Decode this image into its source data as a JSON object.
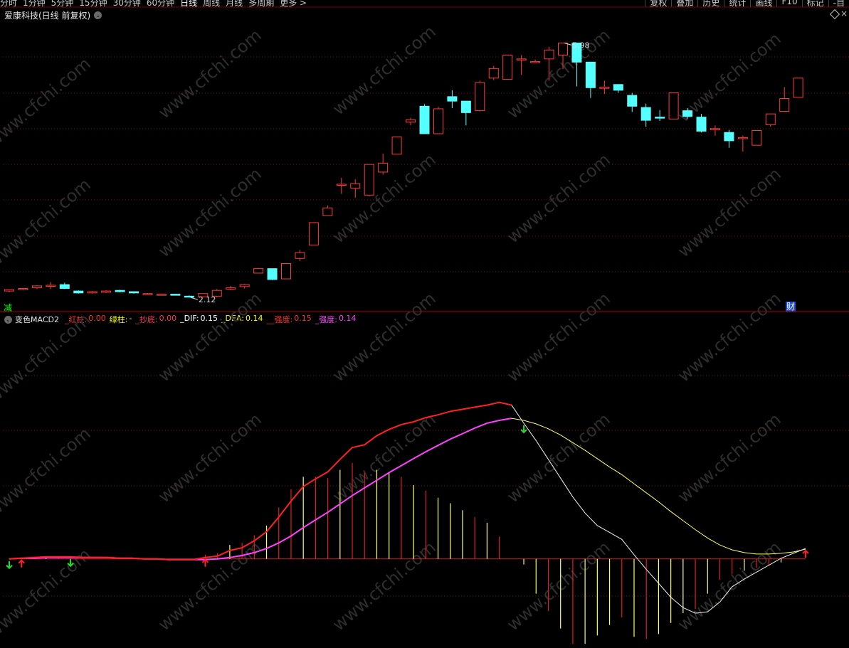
{
  "toolbar": {
    "periods": [
      "分时",
      "1分钟",
      "5分钟",
      "15分钟",
      "30分钟",
      "60分钟",
      "日线",
      "周线",
      "月线",
      "多周期",
      "更多 >"
    ],
    "active_period": "日线",
    "tools": [
      "复权",
      "叠加",
      "历史",
      "统计",
      "画线",
      "F10",
      "标记",
      "-自"
    ]
  },
  "stock": {
    "title": "爱康科技(日线 前复权)",
    "badge_left": "减",
    "badge_right": "财"
  },
  "indicator": {
    "name": "变色MACD2",
    "legend": [
      {
        "label": "_红柱:",
        "value": "0.00",
        "color": "#ff3030"
      },
      {
        "label": "绿柱:",
        "value": "-",
        "color": "#ffff00"
      },
      {
        "label": "_抄底:",
        "value": "0.00",
        "color": "#ff3060"
      },
      {
        "label": "_DIF:",
        "value": "0.15",
        "color": "#ffffff"
      },
      {
        "label": "_DEA:",
        "value": "0.14",
        "color": "#ffff00"
      },
      {
        "label": "__强度:",
        "value": "0.15",
        "color": "#ff3030"
      },
      {
        "label": "_强度:",
        "value": "0.14",
        "color": "#ff40ff"
      }
    ]
  },
  "watermark": "www.cfchi.com",
  "colors": {
    "up": "#ff3b3b",
    "down": "#54ffff",
    "dea_pink": "#ff40ff",
    "dif_red": "#ff2020",
    "yellow": "#ffff66"
  },
  "chart_data": [
    {
      "type": "candlestick",
      "annotations": [
        {
          "label": "5.98",
          "kind": "high"
        },
        {
          "label": "2.12",
          "kind": "low"
        }
      ],
      "ylim": [
        1.95,
        6.4
      ],
      "candles": [
        {
          "o": 2.16,
          "h": 2.18,
          "l": 2.14,
          "c": 2.18
        },
        {
          "o": 2.18,
          "h": 2.2,
          "l": 2.17,
          "c": 2.2
        },
        {
          "o": 2.21,
          "h": 2.25,
          "l": 2.19,
          "c": 2.24
        },
        {
          "o": 2.25,
          "h": 2.3,
          "l": 2.19,
          "c": 2.25
        },
        {
          "o": 2.26,
          "h": 2.29,
          "l": 2.19,
          "c": 2.2
        },
        {
          "o": 2.16,
          "h": 2.17,
          "l": 2.12,
          "c": 2.13
        },
        {
          "o": 2.13,
          "h": 2.16,
          "l": 2.12,
          "c": 2.15
        },
        {
          "o": 2.14,
          "h": 2.17,
          "l": 2.13,
          "c": 2.16
        },
        {
          "o": 2.17,
          "h": 2.18,
          "l": 2.14,
          "c": 2.15
        },
        {
          "o": 2.15,
          "h": 2.15,
          "l": 2.12,
          "c": 2.13
        },
        {
          "o": 2.12,
          "h": 2.13,
          "l": 2.11,
          "c": 2.12
        },
        {
          "o": 2.11,
          "h": 2.12,
          "l": 2.1,
          "c": 2.11
        },
        {
          "o": 2.11,
          "h": 2.11,
          "l": 2.09,
          "c": 2.1
        },
        {
          "o": 2.08,
          "h": 2.09,
          "l": 2.06,
          "c": 2.07
        },
        {
          "o": 2.07,
          "h": 2.12,
          "l": 2.06,
          "c": 2.12
        },
        {
          "o": 2.08,
          "h": 2.19,
          "l": 2.06,
          "c": 2.17
        },
        {
          "o": 2.19,
          "h": 2.24,
          "l": 2.17,
          "c": 2.21
        },
        {
          "o": 2.23,
          "h": 2.27,
          "l": 2.2,
          "c": 2.26
        },
        {
          "o": 2.44,
          "h": 2.52,
          "l": 2.44,
          "c": 2.51
        },
        {
          "o": 2.51,
          "h": 2.51,
          "l": 2.33,
          "c": 2.34
        },
        {
          "o": 2.35,
          "h": 2.6,
          "l": 2.35,
          "c": 2.59
        },
        {
          "o": 2.67,
          "h": 2.8,
          "l": 2.63,
          "c": 2.76
        },
        {
          "o": 2.88,
          "h": 3.23,
          "l": 2.88,
          "c": 3.23
        },
        {
          "o": 3.34,
          "h": 3.5,
          "l": 3.34,
          "c": 3.46
        },
        {
          "o": 3.83,
          "h": 3.93,
          "l": 3.68,
          "c": 3.83
        },
        {
          "o": 3.77,
          "h": 3.91,
          "l": 3.62,
          "c": 3.84
        },
        {
          "o": 3.66,
          "h": 4.14,
          "l": 3.64,
          "c": 4.14
        },
        {
          "o": 4.02,
          "h": 4.31,
          "l": 3.98,
          "c": 4.16
        },
        {
          "o": 4.3,
          "h": 4.57,
          "l": 4.3,
          "c": 4.57
        },
        {
          "o": 4.8,
          "h": 4.87,
          "l": 4.75,
          "c": 4.84
        },
        {
          "o": 5.05,
          "h": 5.08,
          "l": 4.62,
          "c": 4.62
        },
        {
          "o": 4.62,
          "h": 5.04,
          "l": 4.62,
          "c": 5.01
        },
        {
          "o": 5.2,
          "h": 5.3,
          "l": 5.02,
          "c": 5.13
        },
        {
          "o": 5.13,
          "h": 5.12,
          "l": 4.75,
          "c": 4.95
        },
        {
          "o": 4.98,
          "h": 5.45,
          "l": 4.97,
          "c": 5.42
        },
        {
          "o": 5.49,
          "h": 5.68,
          "l": 5.46,
          "c": 5.64
        },
        {
          "o": 5.47,
          "h": 5.85,
          "l": 5.47,
          "c": 5.85
        },
        {
          "o": 5.79,
          "h": 5.85,
          "l": 5.54,
          "c": 5.79
        },
        {
          "o": 5.74,
          "h": 5.78,
          "l": 5.74,
          "c": 5.75
        },
        {
          "o": 5.79,
          "h": 5.98,
          "l": 5.45,
          "c": 5.93
        },
        {
          "o": 5.85,
          "h": 5.98,
          "l": 5.63,
          "c": 6.04
        },
        {
          "o": 6.04,
          "h": 6.04,
          "l": 5.36,
          "c": 5.74
        },
        {
          "o": 5.74,
          "h": 5.59,
          "l": 5.18,
          "c": 5.34
        },
        {
          "o": 5.33,
          "h": 5.45,
          "l": 5.24,
          "c": 5.35
        },
        {
          "o": 5.39,
          "h": 5.39,
          "l": 5.26,
          "c": 5.3
        },
        {
          "o": 5.22,
          "h": 5.26,
          "l": 4.96,
          "c": 5.05
        },
        {
          "o": 5.03,
          "h": 5.09,
          "l": 4.73,
          "c": 4.83
        },
        {
          "o": 4.88,
          "h": 4.99,
          "l": 4.82,
          "c": 4.87
        },
        {
          "o": 4.85,
          "h": 5.26,
          "l": 4.85,
          "c": 5.26
        },
        {
          "o": 4.98,
          "h": 5.02,
          "l": 4.85,
          "c": 4.89
        },
        {
          "o": 4.88,
          "h": 4.93,
          "l": 4.64,
          "c": 4.66
        },
        {
          "o": 4.7,
          "h": 4.75,
          "l": 4.59,
          "c": 4.7
        },
        {
          "o": 4.64,
          "h": 4.68,
          "l": 4.4,
          "c": 4.51
        },
        {
          "o": 4.56,
          "h": 4.59,
          "l": 4.34,
          "c": 4.56
        },
        {
          "o": 4.44,
          "h": 4.67,
          "l": 4.44,
          "c": 4.67
        },
        {
          "o": 4.76,
          "h": 4.93,
          "l": 4.73,
          "c": 4.93
        },
        {
          "o": 4.97,
          "h": 5.35,
          "l": 4.97,
          "c": 5.17
        },
        {
          "o": 5.19,
          "h": 5.49,
          "l": 5.19,
          "c": 5.49
        }
      ]
    },
    {
      "type": "line",
      "ylim": [
        -1.28,
        3.38
      ],
      "series": [
        {
          "name": "_DIF",
          "values": [
            0.0,
            0.01,
            0.02,
            0.03,
            0.03,
            0.03,
            0.02,
            0.02,
            0.02,
            0.01,
            0.01,
            0.0,
            0.0,
            -0.01,
            -0.01,
            -0.01,
            0.02,
            0.04,
            0.12,
            0.16,
            0.26,
            0.39,
            0.6,
            0.83,
            1.04,
            1.15,
            1.25,
            1.43,
            1.6,
            1.64,
            1.77,
            1.86,
            1.93,
            1.97,
            2.03,
            2.07,
            2.12,
            2.15,
            2.18,
            2.21,
            2.25,
            2.21,
            1.95,
            1.7,
            1.43,
            1.16,
            0.89,
            0.66,
            0.48,
            0.38,
            0.28,
            0.06,
            -0.15,
            -0.35,
            -0.55,
            -0.7,
            -0.78,
            -0.76,
            -0.62,
            -0.4,
            -0.29,
            -0.19,
            -0.09,
            0.01,
            0.08,
            0.15
          ]
        },
        {
          "name": "_DEA",
          "values": [
            0.0,
            0.01,
            0.01,
            0.02,
            0.02,
            0.02,
            0.02,
            0.02,
            0.02,
            0.01,
            0.01,
            0.0,
            0.0,
            -0.01,
            -0.01,
            -0.01,
            -0.01,
            0.0,
            0.02,
            0.05,
            0.09,
            0.15,
            0.23,
            0.33,
            0.45,
            0.56,
            0.67,
            0.79,
            0.91,
            1.02,
            1.13,
            1.24,
            1.34,
            1.44,
            1.54,
            1.63,
            1.72,
            1.8,
            1.88,
            1.95,
            1.99,
            2.02,
            1.99,
            1.94,
            1.87,
            1.78,
            1.67,
            1.56,
            1.44,
            1.32,
            1.21,
            1.08,
            0.95,
            0.82,
            0.68,
            0.55,
            0.42,
            0.3,
            0.2,
            0.13,
            0.09,
            0.07,
            0.07,
            0.08,
            0.1,
            0.14
          ]
        }
      ],
      "macd_bars": [
        0.0,
        0.01,
        0.02,
        0.02,
        0.02,
        0.02,
        0.0,
        0.0,
        0.0,
        0.0,
        0.0,
        0.0,
        0.0,
        0.0,
        0.0,
        0.0,
        0.06,
        0.08,
        0.2,
        0.23,
        0.34,
        0.48,
        0.74,
        1.0,
        1.18,
        1.18,
        1.16,
        1.28,
        1.38,
        1.24,
        1.28,
        1.24,
        1.18,
        1.06,
        0.98,
        0.88,
        0.8,
        0.7,
        0.6,
        0.52,
        0.32,
        0.0,
        -0.08,
        -0.5,
        -0.75,
        -1.0,
        -1.22,
        -1.22,
        -1.1,
        -0.95,
        -0.84,
        -1.12,
        -1.15,
        -1.08,
        -0.92,
        -0.78,
        -0.72,
        -0.5,
        -0.3,
        -0.22,
        -0.17,
        -0.13,
        -0.1,
        -0.05,
        0.0,
        0.0
      ],
      "signals": [
        {
          "index": 0,
          "dir": "down"
        },
        {
          "index": 1,
          "dir": "up"
        },
        {
          "index": 5,
          "dir": "down"
        },
        {
          "index": 16,
          "dir": "up"
        },
        {
          "index": 42,
          "dir": "down"
        },
        {
          "index": 65,
          "dir": "up"
        }
      ]
    }
  ]
}
